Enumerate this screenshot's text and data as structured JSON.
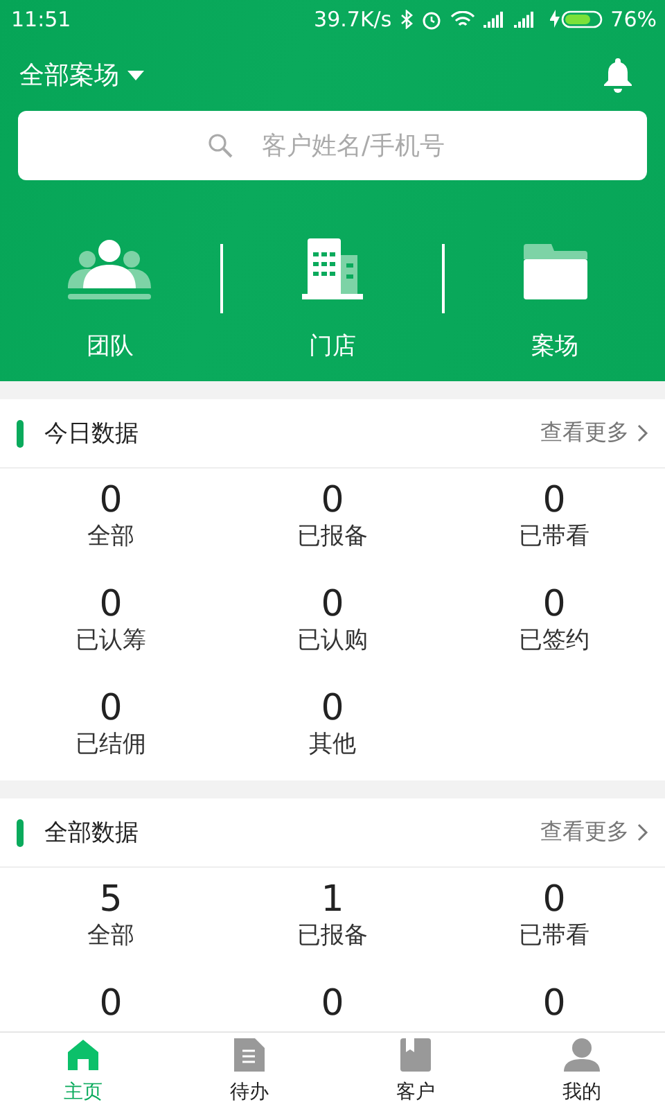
{
  "status_bar": {
    "time": "11:51",
    "speed": "39.7K/s",
    "battery": "76%"
  },
  "header": {
    "project_selector": "全部案场",
    "search": {
      "placeholder": "客户姓名/手机号"
    }
  },
  "shortcuts": [
    {
      "kind": "team",
      "label": "团队"
    },
    {
      "kind": "store",
      "label": "门店"
    },
    {
      "kind": "project",
      "label": "案场"
    }
  ],
  "sections": [
    {
      "title": "今日数据",
      "more": "查看更多",
      "stats": [
        {
          "value": "0",
          "label": "全部"
        },
        {
          "value": "0",
          "label": "已报备"
        },
        {
          "value": "0",
          "label": "已带看"
        },
        {
          "value": "0",
          "label": "已认筹"
        },
        {
          "value": "0",
          "label": "已认购"
        },
        {
          "value": "0",
          "label": "已签约"
        },
        {
          "value": "0",
          "label": "已结佣"
        },
        {
          "value": "0",
          "label": "其他"
        }
      ]
    },
    {
      "title": "全部数据",
      "more": "查看更多",
      "stats": [
        {
          "value": "5",
          "label": "全部"
        },
        {
          "value": "1",
          "label": "已报备"
        },
        {
          "value": "0",
          "label": "已带看"
        },
        {
          "value": "0"
        },
        {
          "value": "0"
        },
        {
          "value": "0"
        }
      ]
    }
  ],
  "tab_bar": [
    {
      "kind": "home",
      "label": "主页",
      "selected": true
    },
    {
      "kind": "todo",
      "label": "待办",
      "selected": false
    },
    {
      "kind": "customer",
      "label": "客户",
      "selected": false
    },
    {
      "kind": "profile",
      "label": "我的",
      "selected": false
    }
  ]
}
